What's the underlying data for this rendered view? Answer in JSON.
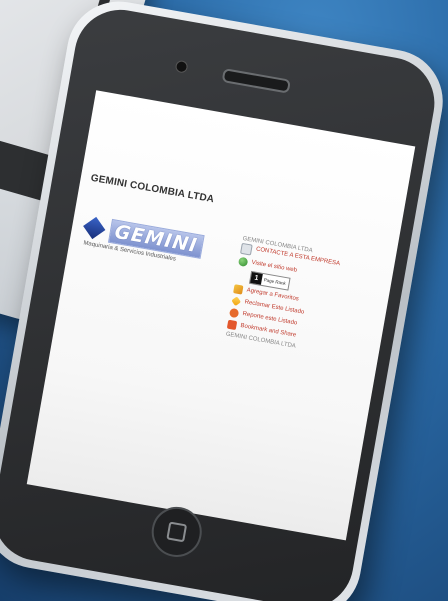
{
  "page": {
    "site_title": "GEMINI COLOMBIA LTDA",
    "logo": {
      "wordmark": "GEMINI",
      "tagline": "Maquinaria & Servicios Industriales"
    },
    "sidebar": {
      "company_name": "GEMINI COLOMBIA LTDA",
      "contact_label": "CONTACTE A ESTA EMPRESA",
      "website_label": "Visite el sitio web",
      "pagerank": {
        "value": "1",
        "label": "Page Rank"
      },
      "favorites_label": "Agregar a Favoritos",
      "claim_label": "Reclamar Este Listado",
      "report_label": "Reporte este Listado",
      "bookmark_label": "Bookmark and Share",
      "footer_company": "GEMINI COLOMBIA LTDA"
    }
  },
  "icons": {
    "contact": "contact-card-icon",
    "website": "globe-icon",
    "favorites": "favorites-icon",
    "claim": "claim-icon",
    "report": "report-icon",
    "bookmark": "bookmark-share-icon"
  }
}
